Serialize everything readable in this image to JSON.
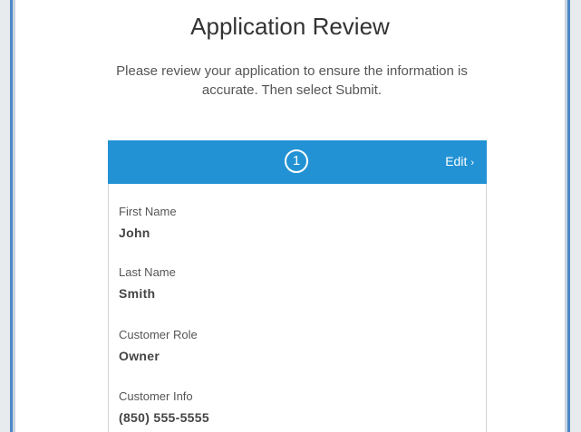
{
  "page": {
    "title": "Application Review",
    "intro": "Please review your application to ensure the information is accurate. Then select Submit."
  },
  "card": {
    "step_number": "1",
    "edit_label": "Edit",
    "edit_icon": "chevron-right-icon",
    "header_color": "#2292d5",
    "fields": [
      {
        "label": "First Name",
        "value": "John"
      },
      {
        "label": "Last Name",
        "value": "Smith"
      },
      {
        "label": "Customer Role",
        "value": "Owner"
      },
      {
        "label": "Customer Info",
        "value": "(850) 555-5555"
      }
    ]
  }
}
